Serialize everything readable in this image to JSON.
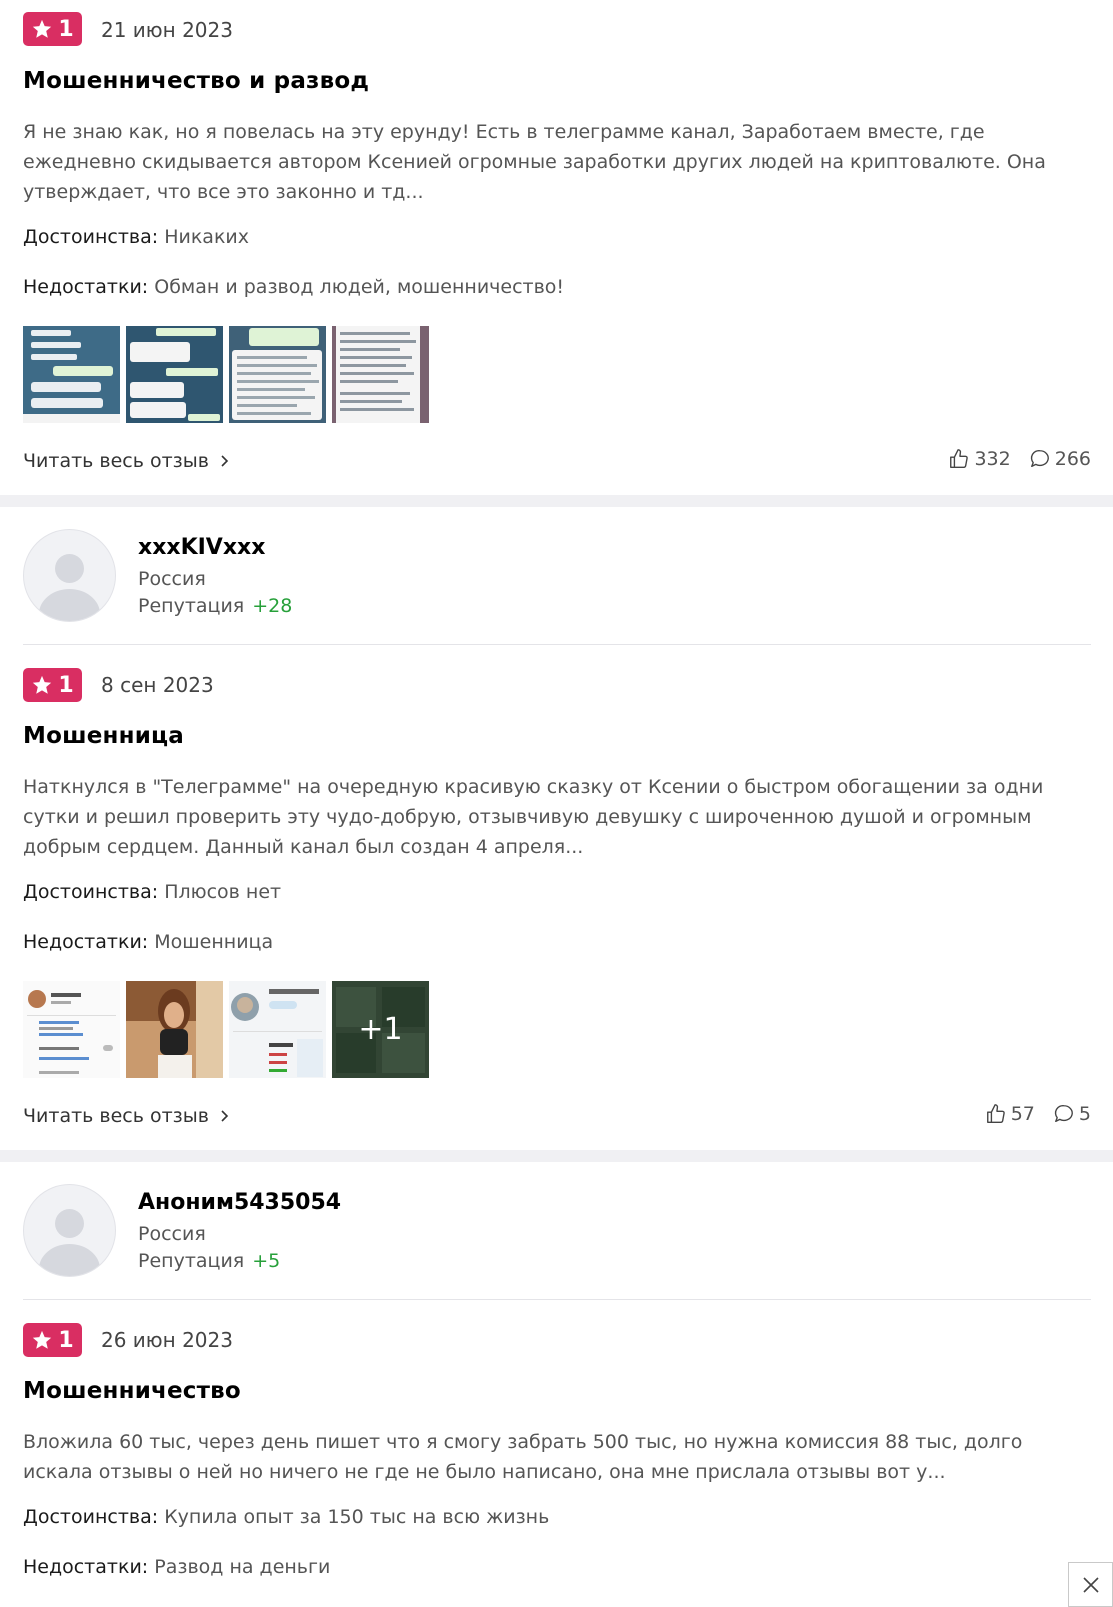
{
  "reviews": [
    {
      "rating": "1",
      "date": "21 июн 2023",
      "title": "Мошенничество и развод",
      "text": "Я не знаю как, но я повелась на эту ерунду! Есть в телеграмме канал, Заработаем вместе, где ежедневно скидывается автором Ксенией огромные заработки других людей на криптовалюте. Она утверждает, что все это законно и тд...",
      "pros_label": "Достоинства:",
      "pros": "Никаких",
      "cons_label": "Недостатки:",
      "cons": "Обман и развод людей, мошенничество!",
      "read_more": "Читать весь отзыв",
      "likes": "332",
      "comments": "266"
    },
    {
      "author": "xxxKIVxxx",
      "country": "Россия",
      "reputation_label": "Репутация",
      "reputation": "+28",
      "rating": "1",
      "date": "8 сен 2023",
      "title": "Мошенница",
      "text": "Наткнулся в \"Телеграмме\" на очередную красивую сказку от Ксении о быстром обогащении за одни сутки и решил проверить эту чудо-добрую, отзывчивую девушку с широченною душой и огромным добрым сердцем. Данный канал был создан 4 апреля...",
      "pros_label": "Достоинства:",
      "pros": "Плюсов нет",
      "cons_label": "Недостатки:",
      "cons": "Мошенница",
      "more_photos": "+1",
      "read_more": "Читать весь отзыв",
      "likes": "57",
      "comments": "5"
    },
    {
      "author": "Аноним5435054",
      "country": "Россия",
      "reputation_label": "Репутация",
      "reputation": "+5",
      "rating": "1",
      "date": "26 июн 2023",
      "title": "Мошенничество",
      "text": "Вложила 60 тыс, через день пишет что я смогу забрать 500 тыс, но нужна комиссия 88 тыс, долго искала отзывы о ней но ничего не где не было написано, она мне прислала отзывы вот у...",
      "pros_label": "Достоинства:",
      "pros": "Купила опыт за 150 тыс на всю жизнь",
      "cons_label": "Недостатки:",
      "cons": "Развод на деньги"
    }
  ],
  "colors": {
    "badge": "#d92e62",
    "reputation": "#27a03a",
    "band": "#f0f0f3"
  },
  "icons": [
    "star-icon",
    "chevron-right-icon",
    "thumbs-up-icon",
    "comment-icon",
    "close-icon",
    "avatar-placeholder-icon"
  ]
}
